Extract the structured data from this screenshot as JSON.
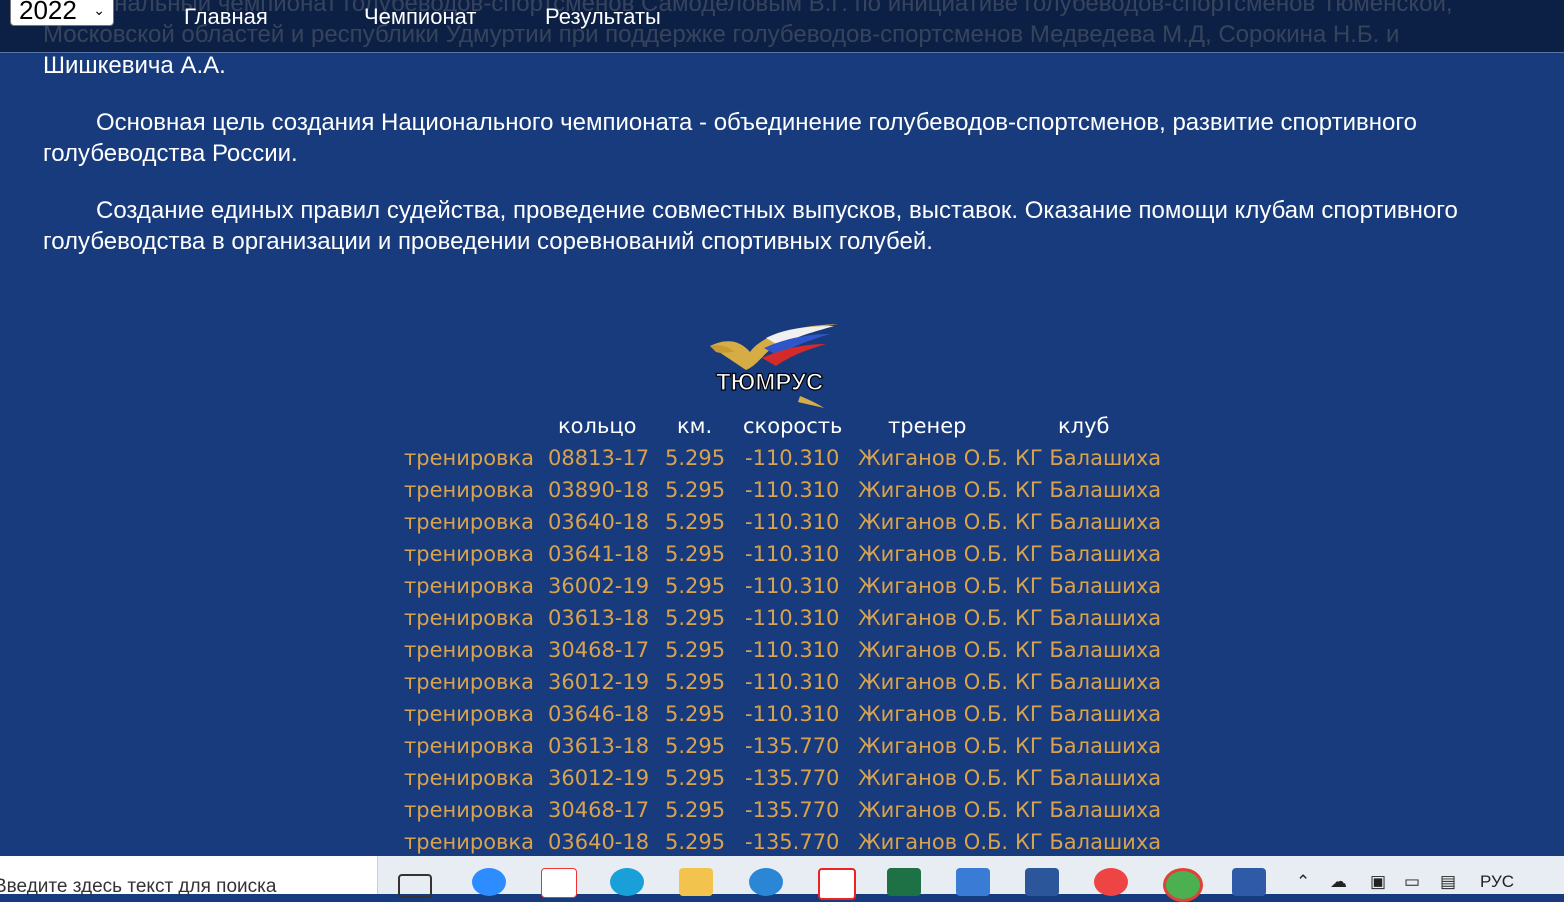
{
  "navbar": {
    "year_select": "2022",
    "links": [
      "Главная",
      "Чемпионат",
      "Результаты"
    ]
  },
  "content": {
    "paragraphs": [
      "Национальный чемпионат голубеводов-спортсменов Самоделовым В.Г. по инициативе голубеводов-спортсменов Тюменской, Московской областей и республики Удмуртии при поддержке голубеводов-спортсменов Медведева М.Д, Сорокина Н.Б. и Шишкевича А.А.",
      "Основная цель создания Национального чемпионата - объединение голубеводов-спортсменов, развитие спортивного голубеводства России.",
      "Создание единых правил судейства, проведение совместных выпусков, выставок. Оказание помощи клубам спортивного голубеводства в организации и проведении соревнований спортивных голубей."
    ]
  },
  "logo": {
    "text": "ТЮМРУС"
  },
  "table": {
    "headers": [
      "",
      "кольцо",
      "км.",
      "скорость",
      "тренер",
      "клуб"
    ],
    "rows": [
      [
        "тренировка",
        "08813-17",
        "5.295",
        "-110.310",
        "Жиганов О.Б.",
        "КГ Балашиха"
      ],
      [
        "тренировка",
        "03890-18",
        "5.295",
        "-110.310",
        "Жиганов О.Б.",
        "КГ Балашиха"
      ],
      [
        "тренировка",
        "03640-18",
        "5.295",
        "-110.310",
        "Жиганов О.Б.",
        "КГ Балашиха"
      ],
      [
        "тренировка",
        "03641-18",
        "5.295",
        "-110.310",
        "Жиганов О.Б.",
        "КГ Балашиха"
      ],
      [
        "тренировка",
        "36002-19",
        "5.295",
        "-110.310",
        "Жиганов О.Б.",
        "КГ Балашиха"
      ],
      [
        "тренировка",
        "03613-18",
        "5.295",
        "-110.310",
        "Жиганов О.Б.",
        "КГ Балашиха"
      ],
      [
        "тренировка",
        "30468-17",
        "5.295",
        "-110.310",
        "Жиганов О.Б.",
        "КГ Балашиха"
      ],
      [
        "тренировка",
        "36012-19",
        "5.295",
        "-110.310",
        "Жиганов О.Б.",
        "КГ Балашиха"
      ],
      [
        "тренировка",
        "03646-18",
        "5.295",
        "-110.310",
        "Жиганов О.Б.",
        "КГ Балашиха"
      ],
      [
        "тренировка",
        "03613-18",
        "5.295",
        "-135.770",
        "Жиганов О.Б.",
        "КГ Балашиха"
      ],
      [
        "тренировка",
        "36012-19",
        "5.295",
        "-135.770",
        "Жиганов О.Б.",
        "КГ Балашиха"
      ],
      [
        "тренировка",
        "30468-17",
        "5.295",
        "-135.770",
        "Жиганов О.Б.",
        "КГ Балашиха"
      ],
      [
        "тренировка",
        "03640-18",
        "5.295",
        "-135.770",
        "Жиганов О.Б.",
        "КГ Балашиха"
      ]
    ]
  },
  "taskbar": {
    "search_placeholder": "Введите здесь текст для поиска",
    "language": "РУС",
    "apps": [
      "task-view",
      "zoom",
      "yandex",
      "edge",
      "explorer",
      "internet-explorer",
      "yandex-browser",
      "excel",
      "mail",
      "word",
      "ccleaner",
      "chrome",
      "reader"
    ]
  },
  "colors": {
    "background": "#173b7c",
    "table_text": "#d9a24f",
    "nav_bg": "#0a1a38"
  }
}
